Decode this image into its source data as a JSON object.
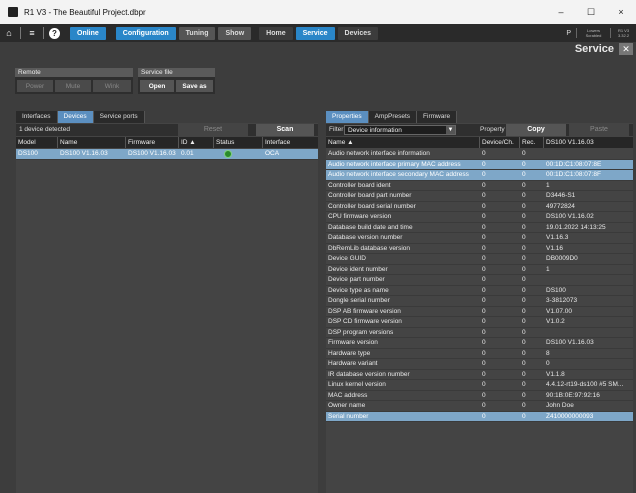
{
  "window": {
    "title": "R1 V3 - The Beautiful Project.dbpr",
    "minimize": "–",
    "maximize": "☐",
    "close": "×"
  },
  "menubar": {
    "home_icon": "⌂",
    "menu_icon": "≡",
    "help_icon": "?",
    "online": "Online",
    "configuration": "Configuration",
    "tuning": "Tuning",
    "show": "Show",
    "home": "Home",
    "service": "Service",
    "devices": "Devices",
    "p_label": "P",
    "status1": "Lowers Scrabled",
    "status2": "R1 V3 3.32.2"
  },
  "service": {
    "title": "Service",
    "close": "✕"
  },
  "remote": {
    "label": "Remote",
    "power": "Power",
    "mute": "Mute",
    "wink": "Wink"
  },
  "service_file": {
    "label": "Service file",
    "open": "Open",
    "save_as": "Save as"
  },
  "left_tabs": [
    "Interfaces",
    "Devices",
    "Service ports"
  ],
  "left_toolbar": {
    "detected": "1 device detected",
    "reset": "Reset",
    "scan": "Scan"
  },
  "device_columns": [
    "Model",
    "Name",
    "Firmware",
    "ID ▲",
    "Status",
    "Interface"
  ],
  "devices": [
    {
      "model": "DS100",
      "name": "DS100 V1.16.03",
      "firmware": "DS100 V1.16.03",
      "id": "0.01",
      "interface": "OCA"
    }
  ],
  "right_tabs": [
    "Properties",
    "AmpPresets",
    "Firmware"
  ],
  "right_toolbar": {
    "filter_label": "Filter",
    "filter_value": "Device information",
    "property_label": "Property",
    "copy": "Copy",
    "paste": "Paste"
  },
  "prop_columns": [
    "Name ▲",
    "Device/Ch.",
    "Rec.",
    "DS100 V1.16.03"
  ],
  "properties": [
    {
      "name": "Audio network interface information",
      "dev": "0",
      "rec": "0",
      "val": "",
      "sel": false
    },
    {
      "name": "Audio network interface primary MAC address",
      "dev": "0",
      "rec": "0",
      "val": "00:1D:C1:08:07:8E",
      "sel": true
    },
    {
      "name": "Audio network interface secondary MAC address",
      "dev": "0",
      "rec": "0",
      "val": "00:1D:C1:08:07:8F",
      "sel": true
    },
    {
      "name": "Controller board ident",
      "dev": "0",
      "rec": "0",
      "val": "1",
      "sel": false
    },
    {
      "name": "Controller board part number",
      "dev": "0",
      "rec": "0",
      "val": "D3446-S1",
      "sel": false
    },
    {
      "name": "Controller board serial number",
      "dev": "0",
      "rec": "0",
      "val": "49772824",
      "sel": false
    },
    {
      "name": "CPU firmware version",
      "dev": "0",
      "rec": "0",
      "val": "DS100 V1.16.02",
      "sel": false
    },
    {
      "name": "Database build date and time",
      "dev": "0",
      "rec": "0",
      "val": "19.01.2022 14:13:25",
      "sel": false
    },
    {
      "name": "Database version number",
      "dev": "0",
      "rec": "0",
      "val": "V1.16.3",
      "sel": false
    },
    {
      "name": "DbRemLib database version",
      "dev": "0",
      "rec": "0",
      "val": "V1.16",
      "sel": false
    },
    {
      "name": "Device GUID",
      "dev": "0",
      "rec": "0",
      "val": "DB0009D0",
      "sel": false
    },
    {
      "name": "Device ident number",
      "dev": "0",
      "rec": "0",
      "val": "1",
      "sel": false
    },
    {
      "name": "Device part number",
      "dev": "0",
      "rec": "0",
      "val": "",
      "sel": false
    },
    {
      "name": "Device type as name",
      "dev": "0",
      "rec": "0",
      "val": "DS100",
      "sel": false
    },
    {
      "name": "Dongle serial number",
      "dev": "0",
      "rec": "0",
      "val": "3-3812073",
      "sel": false
    },
    {
      "name": "DSP AB firmware version",
      "dev": "0",
      "rec": "0",
      "val": "V1.07.00",
      "sel": false
    },
    {
      "name": "DSP CD firmware version",
      "dev": "0",
      "rec": "0",
      "val": "V1.0.2",
      "sel": false
    },
    {
      "name": "DSP program versions",
      "dev": "0",
      "rec": "0",
      "val": "",
      "sel": false
    },
    {
      "name": "Firmware version",
      "dev": "0",
      "rec": "0",
      "val": "DS100 V1.16.03",
      "sel": false
    },
    {
      "name": "Hardware type",
      "dev": "0",
      "rec": "0",
      "val": "8",
      "sel": false
    },
    {
      "name": "Hardware variant",
      "dev": "0",
      "rec": "0",
      "val": "0",
      "sel": false
    },
    {
      "name": "IR database version number",
      "dev": "0",
      "rec": "0",
      "val": "V1.1.8",
      "sel": false
    },
    {
      "name": "Linux kernel version",
      "dev": "0",
      "rec": "0",
      "val": "4.4.12-rt19-ds100 #5 SM...",
      "sel": false
    },
    {
      "name": "MAC address",
      "dev": "0",
      "rec": "0",
      "val": "90:1B:0E:97:92:16",
      "sel": false
    },
    {
      "name": "Owner name",
      "dev": "0",
      "rec": "0",
      "val": "John Doe",
      "sel": false
    },
    {
      "name": "Serial number",
      "dev": "0",
      "rec": "0",
      "val": "Z410000000093",
      "sel": true
    }
  ],
  "colors": {
    "accent": "#2a86c8",
    "selection": "#7ea7c8",
    "status_ok": "#2a8a2a"
  }
}
